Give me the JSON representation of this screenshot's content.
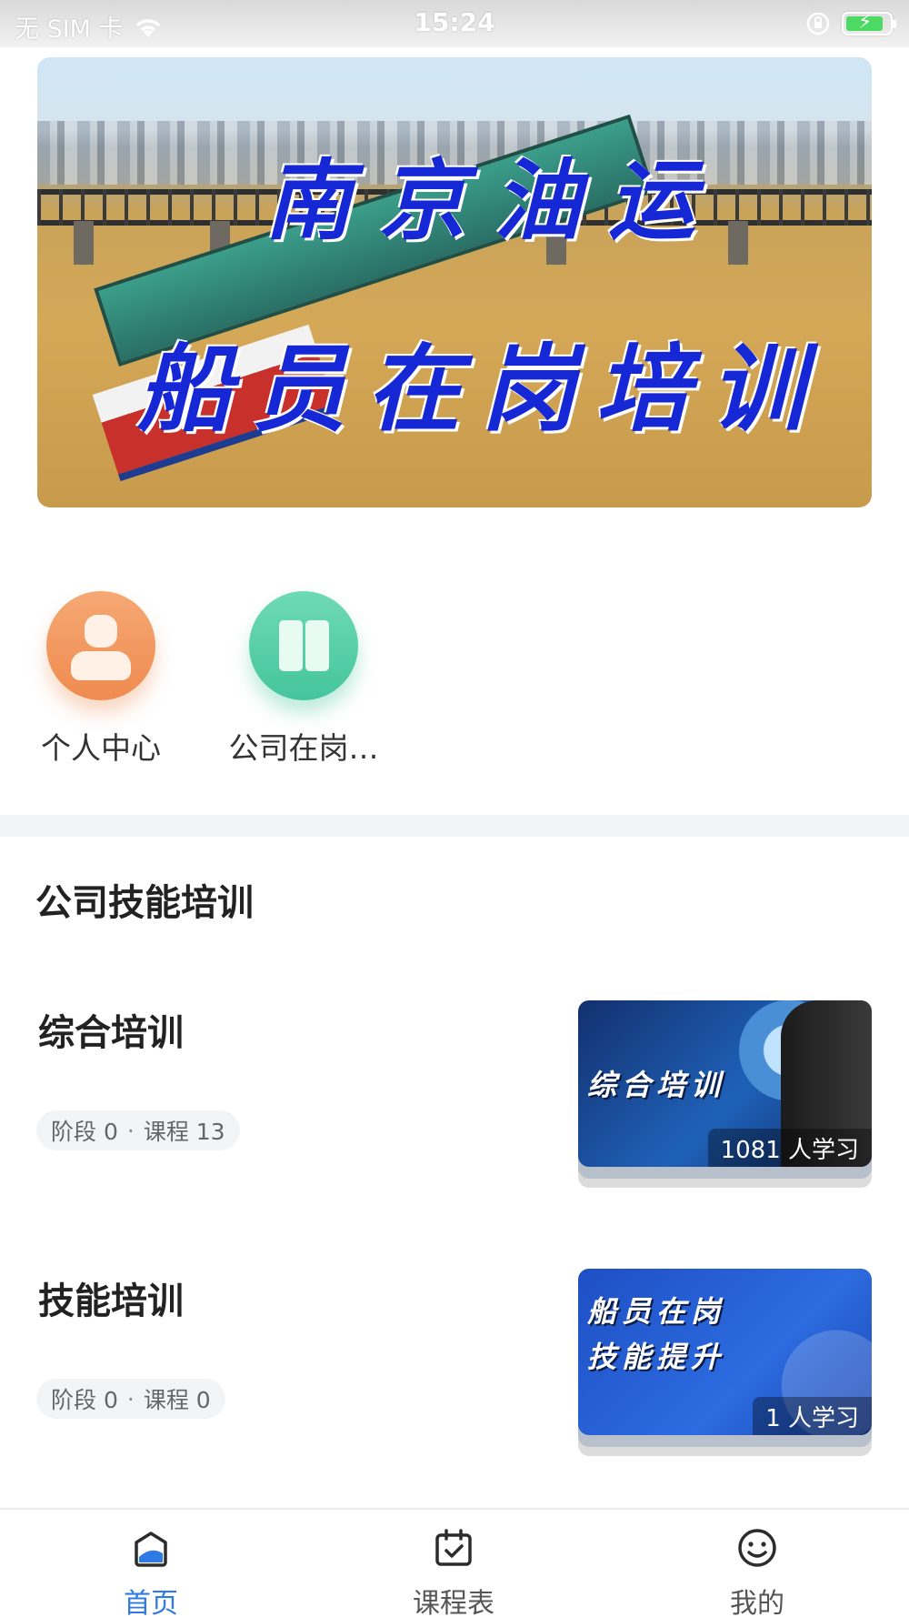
{
  "status_bar": {
    "carrier": "无 SIM 卡",
    "time": "15:24",
    "wifi_icon": "wifi-icon",
    "lock_icon": "orientation-lock-icon",
    "battery_icon": "battery-charging-icon"
  },
  "banner": {
    "line1": "南京油运",
    "line2": "船员在岗培训"
  },
  "quick_entries": [
    {
      "label": "个人中心",
      "icon": "person-icon",
      "color": "#ef8b4f"
    },
    {
      "label": "公司在岗…",
      "icon": "book-icon",
      "color": "#45c59b"
    }
  ],
  "section": {
    "title": "公司技能培训"
  },
  "courses": [
    {
      "title": "综合培训",
      "stage": "阶段 0",
      "separator": "·",
      "lessons": "课程 13",
      "thumb_text": "综合培训",
      "learners": "1081 人学习"
    },
    {
      "title": "技能培训",
      "stage": "阶段 0",
      "separator": "·",
      "lessons": "课程 0",
      "thumb_text_line1": "船员在岗",
      "thumb_text_line2": "技能提升",
      "learners": "1 人学习"
    }
  ],
  "tabbar": {
    "items": [
      {
        "label": "首页",
        "icon": "home-icon",
        "active": true
      },
      {
        "label": "课程表",
        "icon": "calendar-icon",
        "active": false
      },
      {
        "label": "我的",
        "icon": "smiley-icon",
        "active": false
      }
    ],
    "active_color": "#2f7ae5"
  }
}
